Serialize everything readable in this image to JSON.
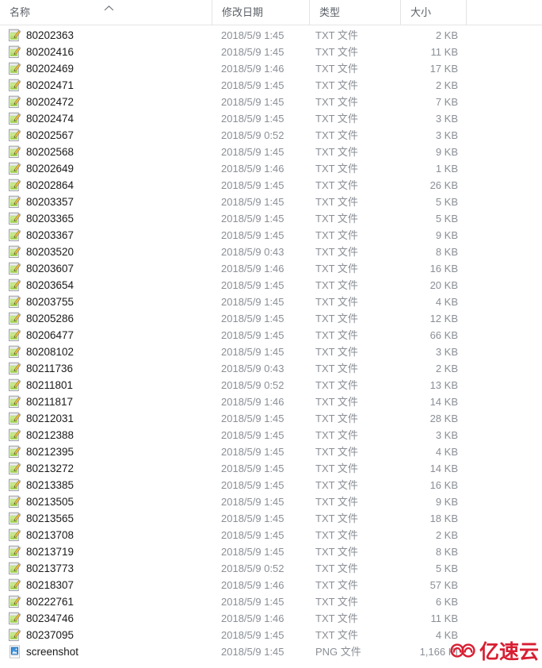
{
  "columns": {
    "name": "名称",
    "date_modified": "修改日期",
    "type": "类型",
    "size": "大小",
    "sort_indicator": "sort-ascending-icon"
  },
  "watermark": {
    "text": "亿速云",
    "color": "#d81e32"
  },
  "files": [
    {
      "name": "80202363",
      "date": "2018/5/9 1:45",
      "type": "TXT 文件",
      "size": "2 KB",
      "icon": "txt-file-icon"
    },
    {
      "name": "80202416",
      "date": "2018/5/9 1:45",
      "type": "TXT 文件",
      "size": "11 KB",
      "icon": "txt-file-icon"
    },
    {
      "name": "80202469",
      "date": "2018/5/9 1:46",
      "type": "TXT 文件",
      "size": "17 KB",
      "icon": "txt-file-icon"
    },
    {
      "name": "80202471",
      "date": "2018/5/9 1:45",
      "type": "TXT 文件",
      "size": "2 KB",
      "icon": "txt-file-icon"
    },
    {
      "name": "80202472",
      "date": "2018/5/9 1:45",
      "type": "TXT 文件",
      "size": "7 KB",
      "icon": "txt-file-icon"
    },
    {
      "name": "80202474",
      "date": "2018/5/9 1:45",
      "type": "TXT 文件",
      "size": "3 KB",
      "icon": "txt-file-icon"
    },
    {
      "name": "80202567",
      "date": "2018/5/9 0:52",
      "type": "TXT 文件",
      "size": "3 KB",
      "icon": "txt-file-icon"
    },
    {
      "name": "80202568",
      "date": "2018/5/9 1:45",
      "type": "TXT 文件",
      "size": "9 KB",
      "icon": "txt-file-icon"
    },
    {
      "name": "80202649",
      "date": "2018/5/9 1:46",
      "type": "TXT 文件",
      "size": "1 KB",
      "icon": "txt-file-icon"
    },
    {
      "name": "80202864",
      "date": "2018/5/9 1:45",
      "type": "TXT 文件",
      "size": "26 KB",
      "icon": "txt-file-icon"
    },
    {
      "name": "80203357",
      "date": "2018/5/9 1:45",
      "type": "TXT 文件",
      "size": "5 KB",
      "icon": "txt-file-icon"
    },
    {
      "name": "80203365",
      "date": "2018/5/9 1:45",
      "type": "TXT 文件",
      "size": "5 KB",
      "icon": "txt-file-icon"
    },
    {
      "name": "80203367",
      "date": "2018/5/9 1:45",
      "type": "TXT 文件",
      "size": "9 KB",
      "icon": "txt-file-icon"
    },
    {
      "name": "80203520",
      "date": "2018/5/9 0:43",
      "type": "TXT 文件",
      "size": "8 KB",
      "icon": "txt-file-icon"
    },
    {
      "name": "80203607",
      "date": "2018/5/9 1:46",
      "type": "TXT 文件",
      "size": "16 KB",
      "icon": "txt-file-icon"
    },
    {
      "name": "80203654",
      "date": "2018/5/9 1:45",
      "type": "TXT 文件",
      "size": "20 KB",
      "icon": "txt-file-icon"
    },
    {
      "name": "80203755",
      "date": "2018/5/9 1:45",
      "type": "TXT 文件",
      "size": "4 KB",
      "icon": "txt-file-icon"
    },
    {
      "name": "80205286",
      "date": "2018/5/9 1:45",
      "type": "TXT 文件",
      "size": "12 KB",
      "icon": "txt-file-icon"
    },
    {
      "name": "80206477",
      "date": "2018/5/9 1:45",
      "type": "TXT 文件",
      "size": "66 KB",
      "icon": "txt-file-icon"
    },
    {
      "name": "80208102",
      "date": "2018/5/9 1:45",
      "type": "TXT 文件",
      "size": "3 KB",
      "icon": "txt-file-icon"
    },
    {
      "name": "80211736",
      "date": "2018/5/9 0:43",
      "type": "TXT 文件",
      "size": "2 KB",
      "icon": "txt-file-icon"
    },
    {
      "name": "80211801",
      "date": "2018/5/9 0:52",
      "type": "TXT 文件",
      "size": "13 KB",
      "icon": "txt-file-icon"
    },
    {
      "name": "80211817",
      "date": "2018/5/9 1:46",
      "type": "TXT 文件",
      "size": "14 KB",
      "icon": "txt-file-icon"
    },
    {
      "name": "80212031",
      "date": "2018/5/9 1:45",
      "type": "TXT 文件",
      "size": "28 KB",
      "icon": "txt-file-icon"
    },
    {
      "name": "80212388",
      "date": "2018/5/9 1:45",
      "type": "TXT 文件",
      "size": "3 KB",
      "icon": "txt-file-icon"
    },
    {
      "name": "80212395",
      "date": "2018/5/9 1:45",
      "type": "TXT 文件",
      "size": "4 KB",
      "icon": "txt-file-icon"
    },
    {
      "name": "80213272",
      "date": "2018/5/9 1:45",
      "type": "TXT 文件",
      "size": "14 KB",
      "icon": "txt-file-icon"
    },
    {
      "name": "80213385",
      "date": "2018/5/9 1:45",
      "type": "TXT 文件",
      "size": "16 KB",
      "icon": "txt-file-icon"
    },
    {
      "name": "80213505",
      "date": "2018/5/9 1:45",
      "type": "TXT 文件",
      "size": "9 KB",
      "icon": "txt-file-icon"
    },
    {
      "name": "80213565",
      "date": "2018/5/9 1:45",
      "type": "TXT 文件",
      "size": "18 KB",
      "icon": "txt-file-icon"
    },
    {
      "name": "80213708",
      "date": "2018/5/9 1:45",
      "type": "TXT 文件",
      "size": "2 KB",
      "icon": "txt-file-icon"
    },
    {
      "name": "80213719",
      "date": "2018/5/9 1:45",
      "type": "TXT 文件",
      "size": "8 KB",
      "icon": "txt-file-icon"
    },
    {
      "name": "80213773",
      "date": "2018/5/9 0:52",
      "type": "TXT 文件",
      "size": "5 KB",
      "icon": "txt-file-icon"
    },
    {
      "name": "80218307",
      "date": "2018/5/9 1:46",
      "type": "TXT 文件",
      "size": "57 KB",
      "icon": "txt-file-icon"
    },
    {
      "name": "80222761",
      "date": "2018/5/9 1:45",
      "type": "TXT 文件",
      "size": "6 KB",
      "icon": "txt-file-icon"
    },
    {
      "name": "80234746",
      "date": "2018/5/9 1:46",
      "type": "TXT 文件",
      "size": "11 KB",
      "icon": "txt-file-icon"
    },
    {
      "name": "80237095",
      "date": "2018/5/9 1:45",
      "type": "TXT 文件",
      "size": "4 KB",
      "icon": "txt-file-icon"
    },
    {
      "name": "screenshot",
      "date": "2018/5/9 1:45",
      "type": "PNG 文件",
      "size": "1,166 KI",
      "icon": "png-file-icon"
    }
  ]
}
